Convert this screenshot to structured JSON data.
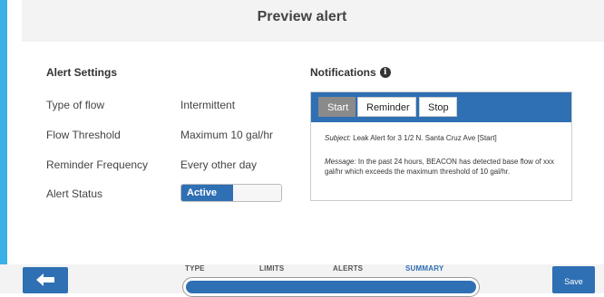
{
  "header": {
    "title": "Preview alert"
  },
  "settings": {
    "heading": "Alert Settings",
    "rows": [
      {
        "label": "Type of flow",
        "value": "Intermittent"
      },
      {
        "label": "Flow Threshold",
        "value": "Maximum 10 gal/hr"
      },
      {
        "label": "Reminder Frequency",
        "value": "Every other day"
      }
    ],
    "status_label": "Alert Status",
    "status_toggle": "Active"
  },
  "notifications": {
    "heading": "Notifications",
    "info_icon": "info-icon",
    "tabs": [
      "Start",
      "Reminder",
      "Stop"
    ],
    "active_tab": "Start",
    "subject_label": "Subject:",
    "subject_text": "Leak Alert for 3 1/2 N. Santa Cruz Ave [Start]",
    "message_label": "Message:",
    "message_text": "In the past 24 hours, BEACON has detected base flow of xxx gal/hr which exceeds the maximum threshold of 10 gal/hr."
  },
  "footer": {
    "back_icon": "arrow-left-icon",
    "save_label": "Save",
    "steps": [
      "TYPE",
      "LIMITS",
      "ALERTS",
      "SUMMARY"
    ],
    "current_step": "SUMMARY",
    "progress": 1.0
  },
  "colors": {
    "accent": "#2f6fb4",
    "left_bar": "#3ab0e6"
  }
}
